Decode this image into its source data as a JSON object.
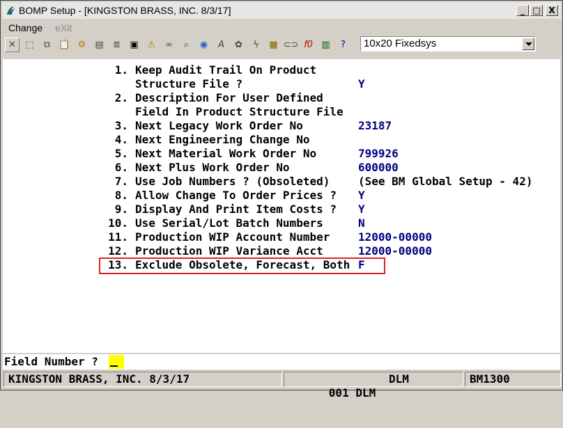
{
  "window": {
    "title": "BOMP Setup - [KINGSTON BRASS, INC. 8/3/17]",
    "controls": {
      "minimize": "_",
      "maximize": "□",
      "close": "X"
    }
  },
  "menu": [
    {
      "label": "Change",
      "enabled": true
    },
    {
      "label": "eXit",
      "enabled": false
    }
  ],
  "toolbar": {
    "icons": [
      "close-icon",
      "blank-icon",
      "copy-icon",
      "paste-icon",
      "settings-icon",
      "clipboard-icon",
      "list-icon",
      "camera-icon",
      "warning-icon",
      "binoculars-icon",
      "search-icon",
      "globe-icon",
      "font-icon",
      "palette-icon",
      "lightning-icon",
      "calculator-icon",
      "link-icon",
      "function-icon",
      "notes-icon",
      "help-icon"
    ],
    "font_select": "10x20 Fixedsys"
  },
  "fields": [
    {
      "num": "1.",
      "label": "Keep Audit Trail On Product",
      "value": ""
    },
    {
      "num": "",
      "label": "Structure File ?",
      "value": "Y"
    },
    {
      "num": "2.",
      "label": "Description For User Defined",
      "value": ""
    },
    {
      "num": "",
      "label": "Field In Product Structure File",
      "value": ""
    },
    {
      "num": "3.",
      "label": "Next Legacy Work Order No",
      "value": "23187"
    },
    {
      "num": "4.",
      "label": "Next Engineering Change No",
      "value": ""
    },
    {
      "num": "5.",
      "label": "Next Material Work Order No",
      "value": "799926"
    },
    {
      "num": "6.",
      "label": "Next Plus Work Order No",
      "value": "600000"
    },
    {
      "num": "7.",
      "label": "Use Job Numbers ? (Obsoleted)",
      "value": "(See BM Global Setup - 42)"
    },
    {
      "num": "8.",
      "label": "Allow Change To Order Prices ?",
      "value": "Y"
    },
    {
      "num": "9.",
      "label": "Display And Print Item Costs ?",
      "value": "Y"
    },
    {
      "num": "10.",
      "label": "Use Serial/Lot Batch Numbers",
      "value": "N"
    },
    {
      "num": "11.",
      "label": "Production WIP Account Number",
      "value": "12000-00000"
    },
    {
      "num": "12.",
      "label": "Production WIP Variance Acct",
      "value": "12000-00000"
    },
    {
      "num": "13.",
      "label": "Exclude Obsolete, Forecast, Both",
      "value": "F"
    }
  ],
  "prompt": {
    "label": "Field Number ?"
  },
  "status": {
    "company": "KINGSTON BRASS, INC. 8/3/17",
    "user": "001 DLM",
    "user2": "DLM",
    "program": "BM1300"
  }
}
